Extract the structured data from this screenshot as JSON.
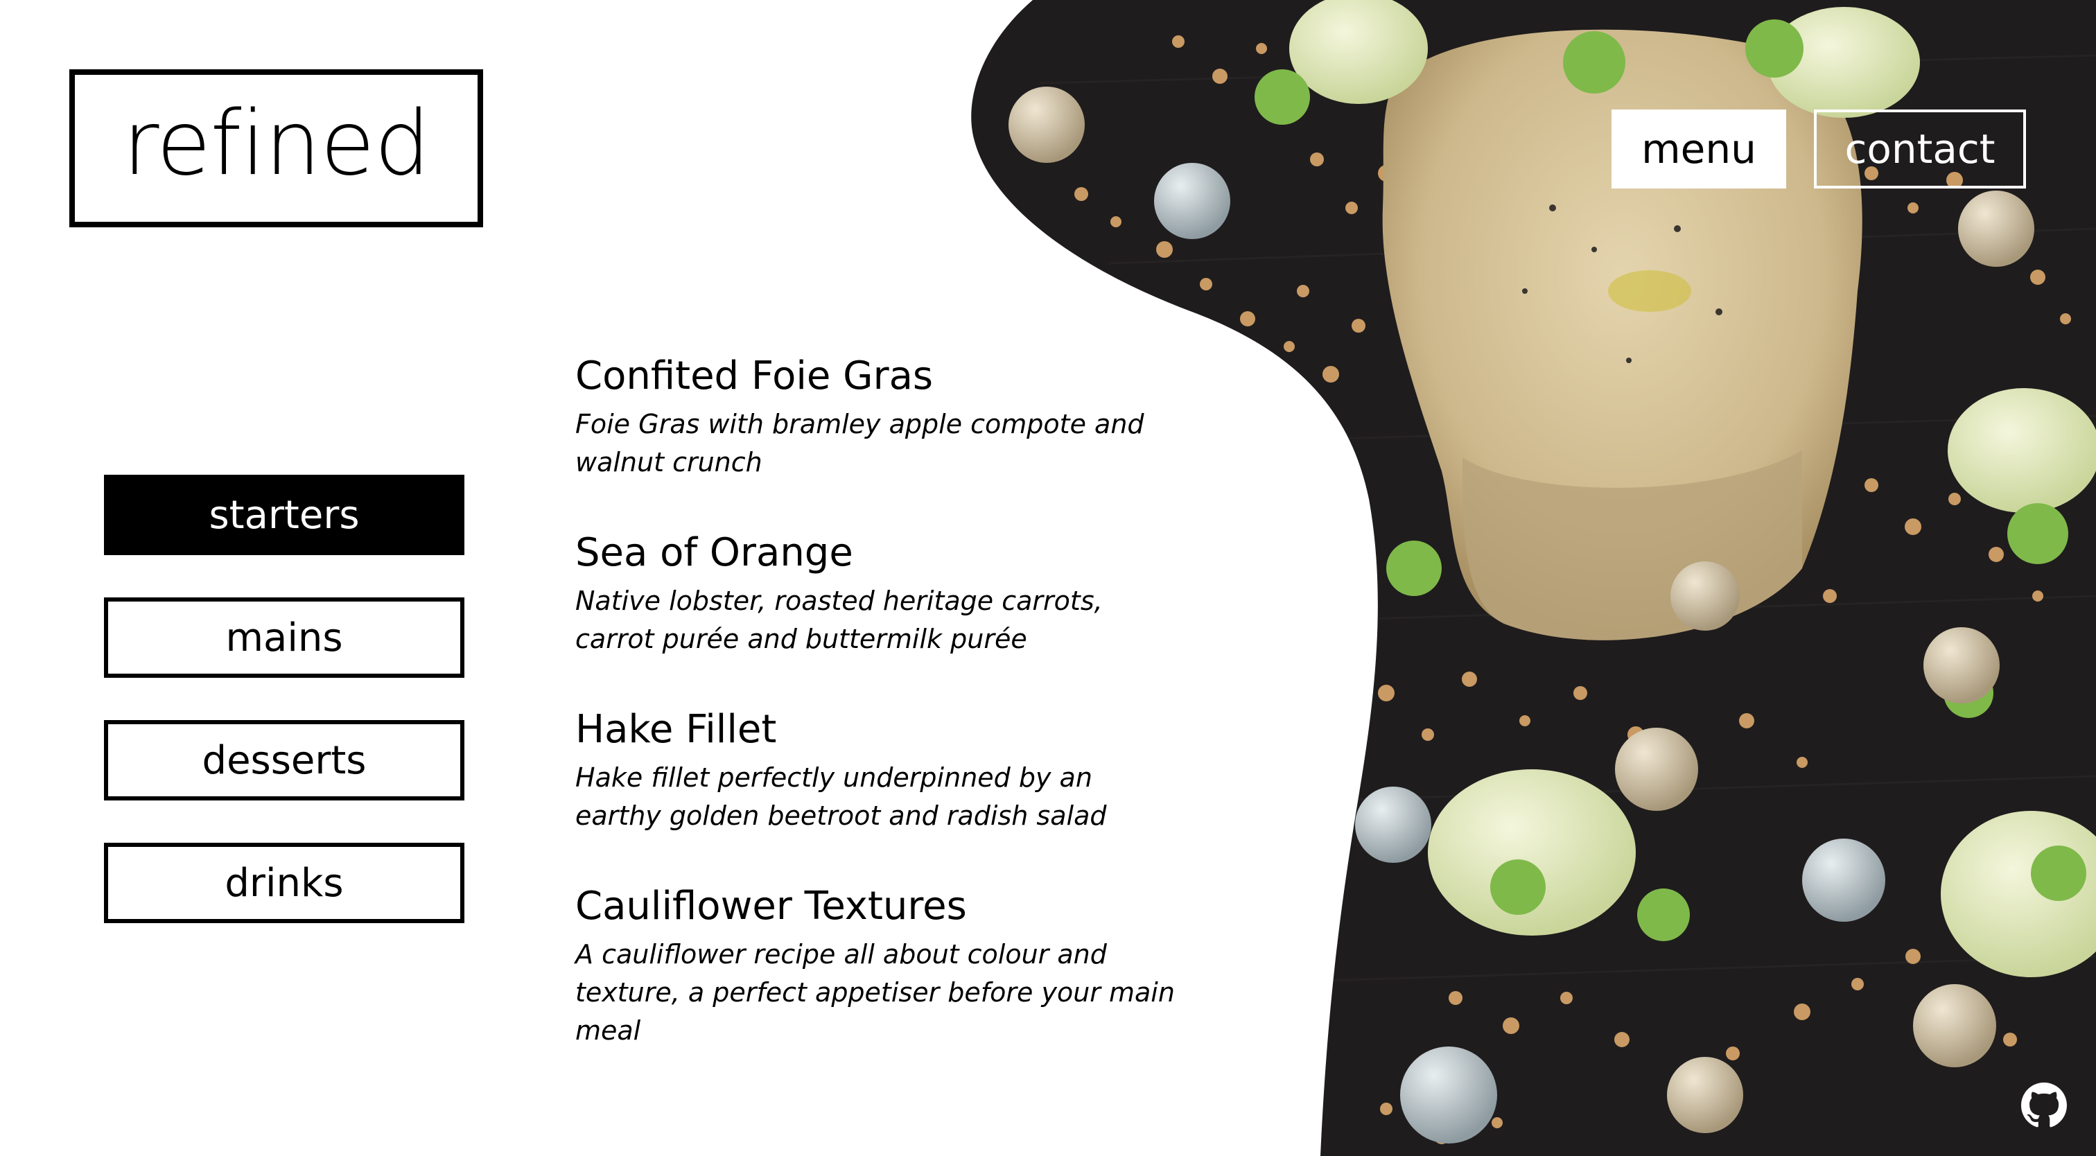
{
  "brand": {
    "logo_text": "refined"
  },
  "top_nav": {
    "menu_label": "menu",
    "contact_label": "contact"
  },
  "categories": [
    {
      "label": "starters",
      "active": true
    },
    {
      "label": "mains",
      "active": false
    },
    {
      "label": "desserts",
      "active": false
    },
    {
      "label": "drinks",
      "active": false
    }
  ],
  "dishes": [
    {
      "name": "Confited Foie Gras",
      "description": "Foie Gras with bramley apple compote and walnut crunch"
    },
    {
      "name": "Sea of Orange",
      "description": "Native lobster, roasted heritage carrots, carrot purée and buttermilk purée"
    },
    {
      "name": "Hake Fillet",
      "description": "Hake fillet perfectly underpinned by an earthy golden beetroot and radish salad"
    },
    {
      "name": "Cauliflower Textures",
      "description": "A cauliflower recipe all about colour and texture, a perfect appetiser before your main meal"
    }
  ],
  "footer": {
    "github_icon": "github-icon"
  },
  "colors": {
    "background": "#ffffff",
    "text": "#000000",
    "photo_slate": "#1f1c1d",
    "foie_gras": "#d8c7a0",
    "crumb": "#c99a63",
    "apple_gel": "#e6ecc4",
    "herb": "#7fb94a"
  }
}
